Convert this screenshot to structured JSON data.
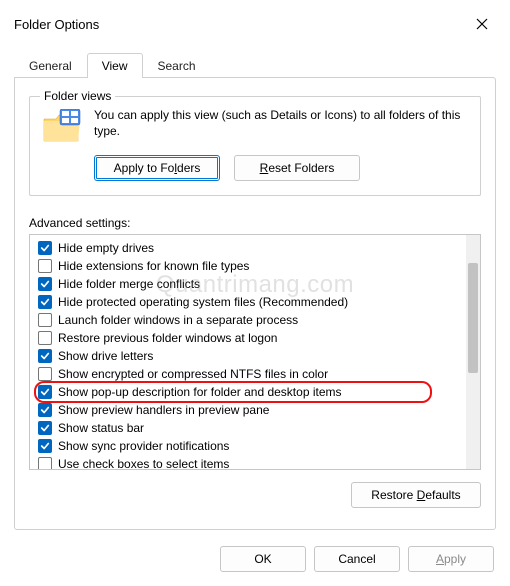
{
  "title": "Folder Options",
  "tabs": [
    "General",
    "View",
    "Search"
  ],
  "activeTab": 1,
  "folderViews": {
    "legend": "Folder views",
    "text": "You can apply this view (such as Details or Icons) to all folders of this type.",
    "applyBtn": "Apply to Folders",
    "applyAccel": "l",
    "resetBtn": "Reset Folders",
    "resetAccel": "R"
  },
  "advancedLabel": "Advanced settings:",
  "advanced": [
    {
      "label": "Hide empty drives",
      "checked": true
    },
    {
      "label": "Hide extensions for known file types",
      "checked": false
    },
    {
      "label": "Hide folder merge conflicts",
      "checked": true
    },
    {
      "label": "Hide protected operating system files (Recommended)",
      "checked": true
    },
    {
      "label": "Launch folder windows in a separate process",
      "checked": false
    },
    {
      "label": "Restore previous folder windows at logon",
      "checked": false
    },
    {
      "label": "Show drive letters",
      "checked": true
    },
    {
      "label": "Show encrypted or compressed NTFS files in color",
      "checked": false
    },
    {
      "label": "Show pop-up description for folder and desktop items",
      "checked": true,
      "highlighted": true
    },
    {
      "label": "Show preview handlers in preview pane",
      "checked": true
    },
    {
      "label": "Show status bar",
      "checked": true
    },
    {
      "label": "Show sync provider notifications",
      "checked": true
    },
    {
      "label": "Use check boxes to select items",
      "checked": false
    }
  ],
  "restoreDefaults": "Restore Defaults",
  "restoreAccel": "D",
  "footer": {
    "ok": "OK",
    "cancel": "Cancel",
    "apply": "Apply",
    "applyAccel": "A"
  },
  "watermark": "Quantrimang.com"
}
